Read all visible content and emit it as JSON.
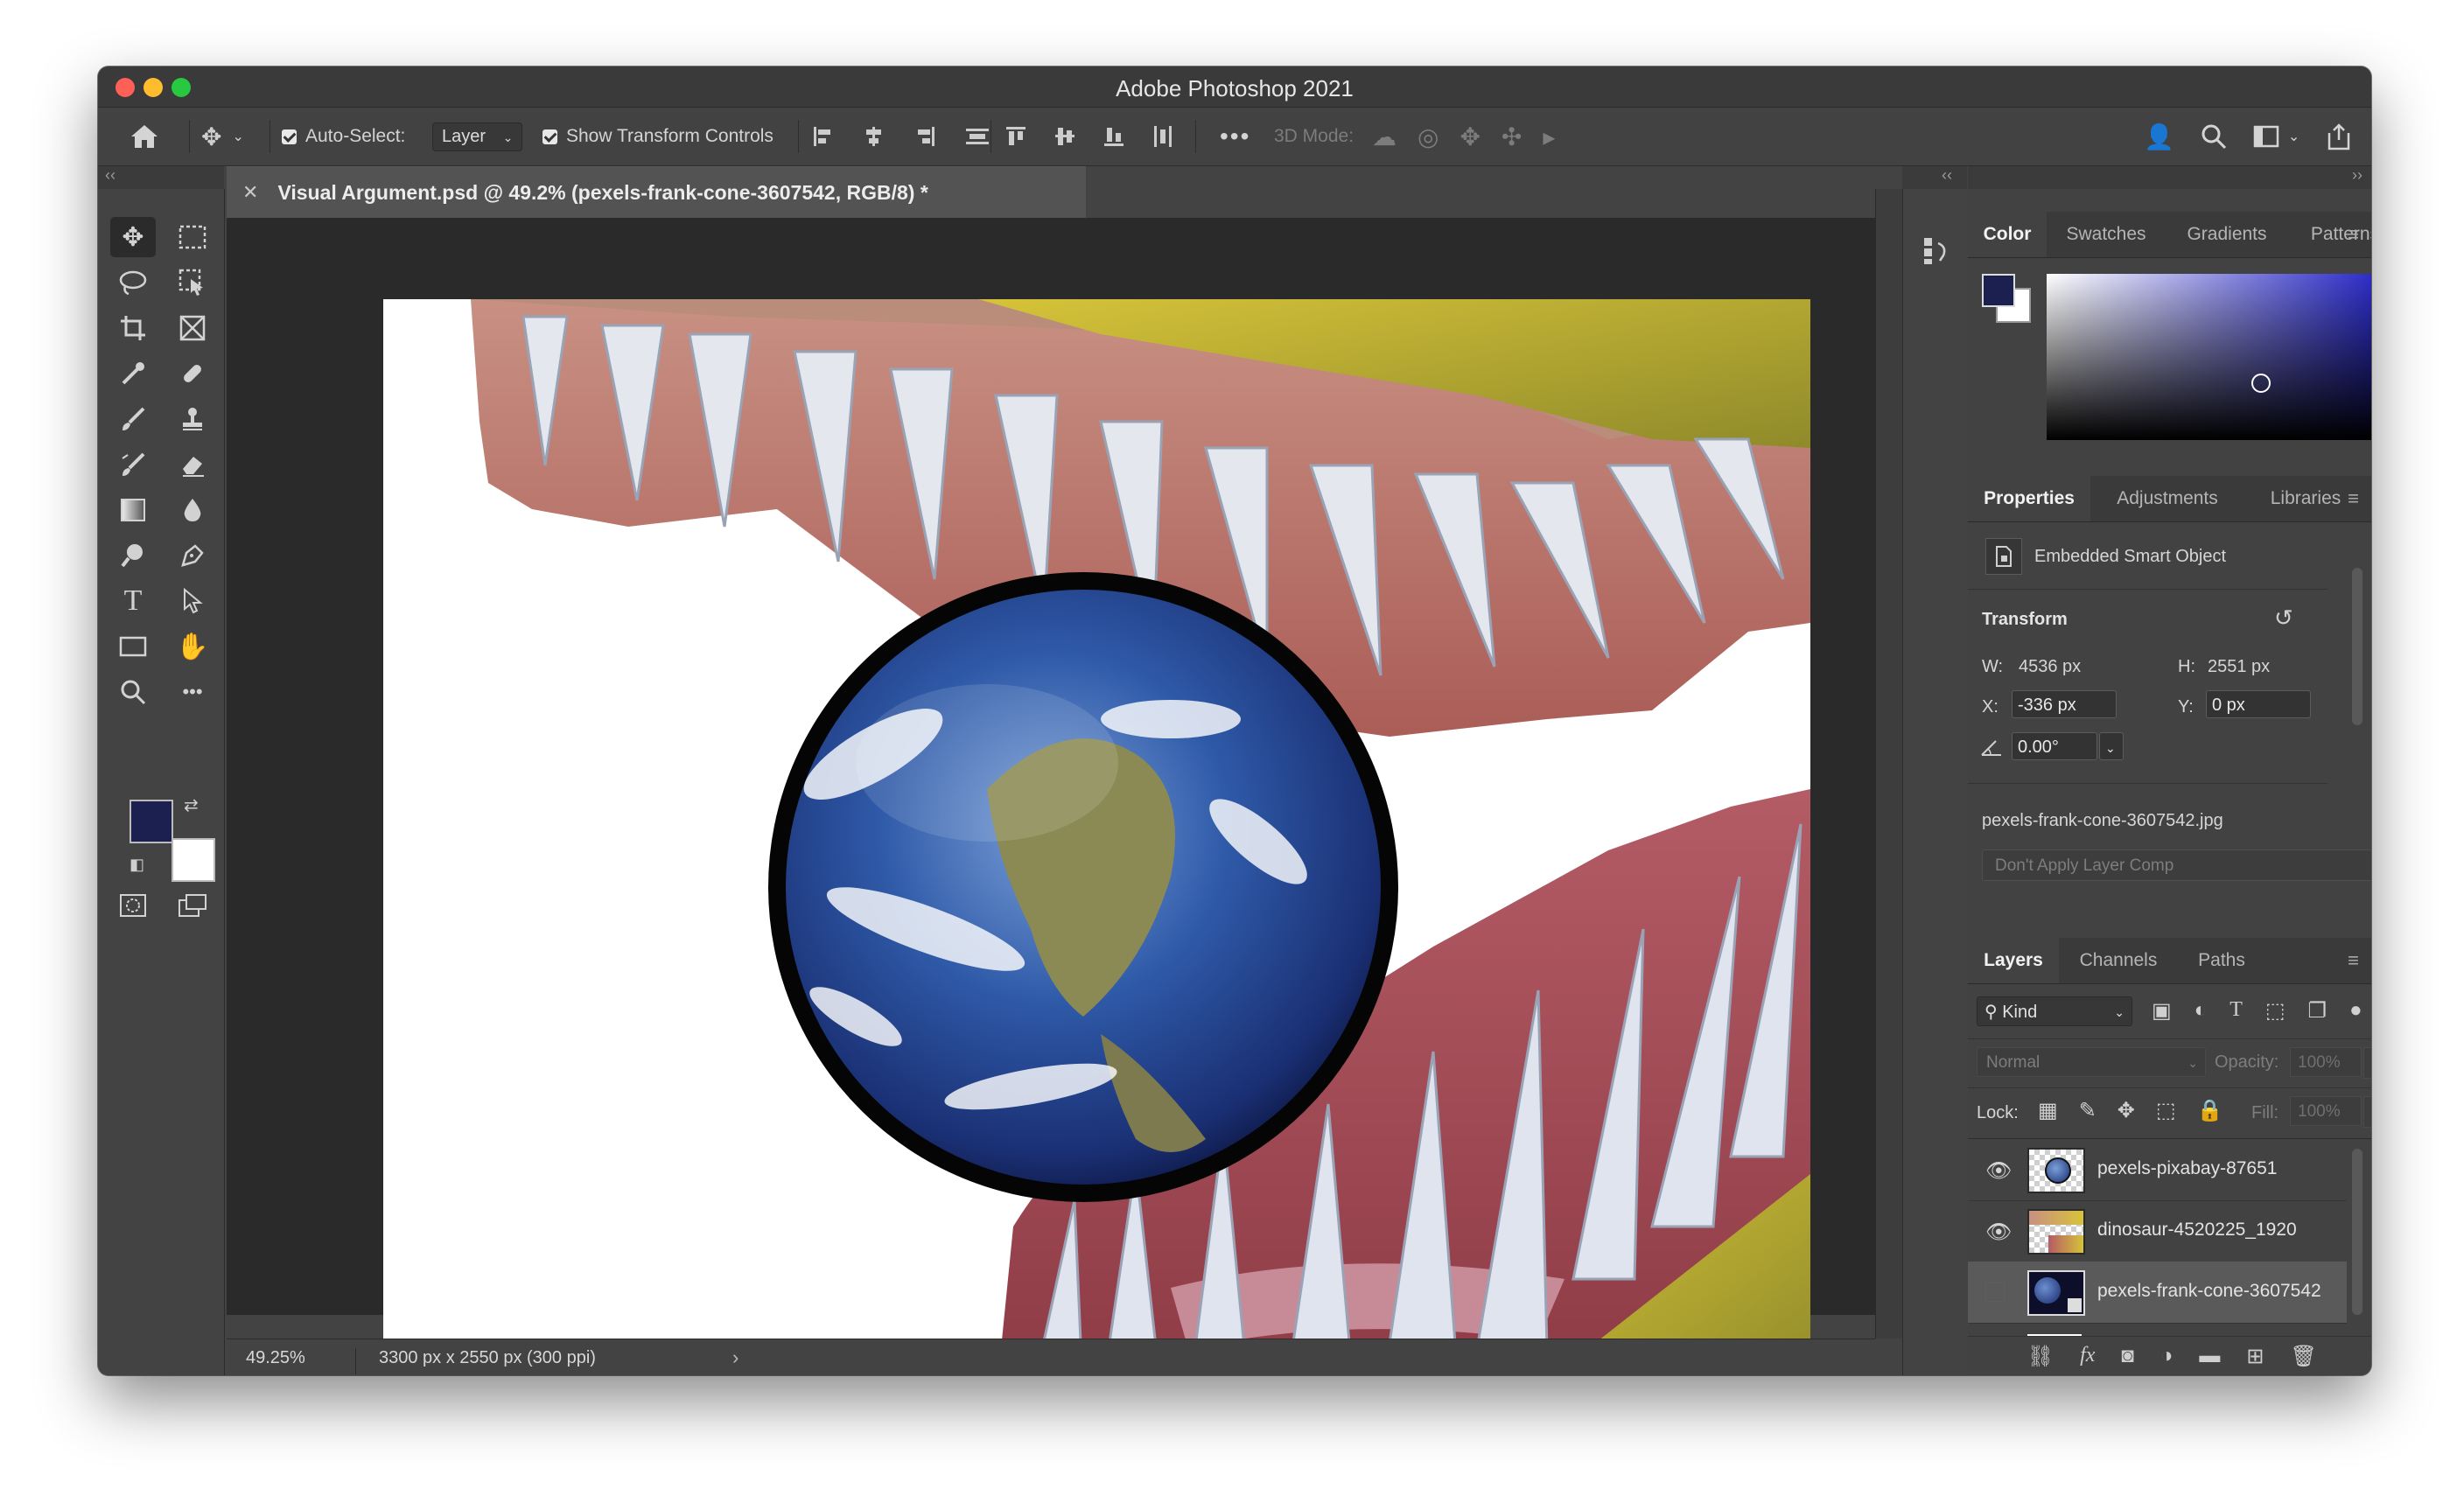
{
  "window": {
    "title": "Adobe Photoshop 2021"
  },
  "options_bar": {
    "auto_select_label": "Auto-Select:",
    "auto_select_value": "Layer",
    "show_transform_label": "Show Transform Controls",
    "mode_3d_label": "3D Mode:"
  },
  "document": {
    "tab_title": "Visual Argument.psd @ 49.2% (pexels-frank-cone-3607542, RGB/8) *",
    "zoom": "49.25%",
    "dimensions": "3300 px x 2550 px (300 ppi)"
  },
  "colors": {
    "foreground": "#1c2050",
    "background": "#ffffff",
    "picker_hue": "#2a2ac8"
  },
  "color_panel": {
    "tabs": [
      {
        "label": "Color"
      },
      {
        "label": "Swatches"
      },
      {
        "label": "Gradients"
      },
      {
        "label": "Patterns"
      }
    ]
  },
  "properties_panel": {
    "tabs": [
      {
        "label": "Properties"
      },
      {
        "label": "Adjustments"
      },
      {
        "label": "Libraries"
      }
    ],
    "object_type": "Embedded Smart Object",
    "transform_heading": "Transform",
    "w_label": "W:",
    "w_value": "4536 px",
    "h_label": "H:",
    "h_value": "2551 px",
    "x_label": "X:",
    "x_value": "-336 px",
    "y_label": "Y:",
    "y_value": "0 px",
    "angle_value": "0.00°",
    "source_file": "pexels-frank-cone-3607542.jpg",
    "layer_comp": "Don't Apply Layer Comp"
  },
  "layers_panel": {
    "tabs": [
      {
        "label": "Layers"
      },
      {
        "label": "Channels"
      },
      {
        "label": "Paths"
      }
    ],
    "filter_kind": "Kind",
    "blend_mode": "Normal",
    "opacity_label": "Opacity:",
    "opacity_value": "100%",
    "lock_label": "Lock:",
    "fill_label": "Fill:",
    "fill_value": "100%",
    "layers": [
      {
        "name": "pexels-pixabay-87651"
      },
      {
        "name": "dinosaur-4520225_1920"
      },
      {
        "name": "pexels-frank-cone-3607542"
      }
    ]
  }
}
